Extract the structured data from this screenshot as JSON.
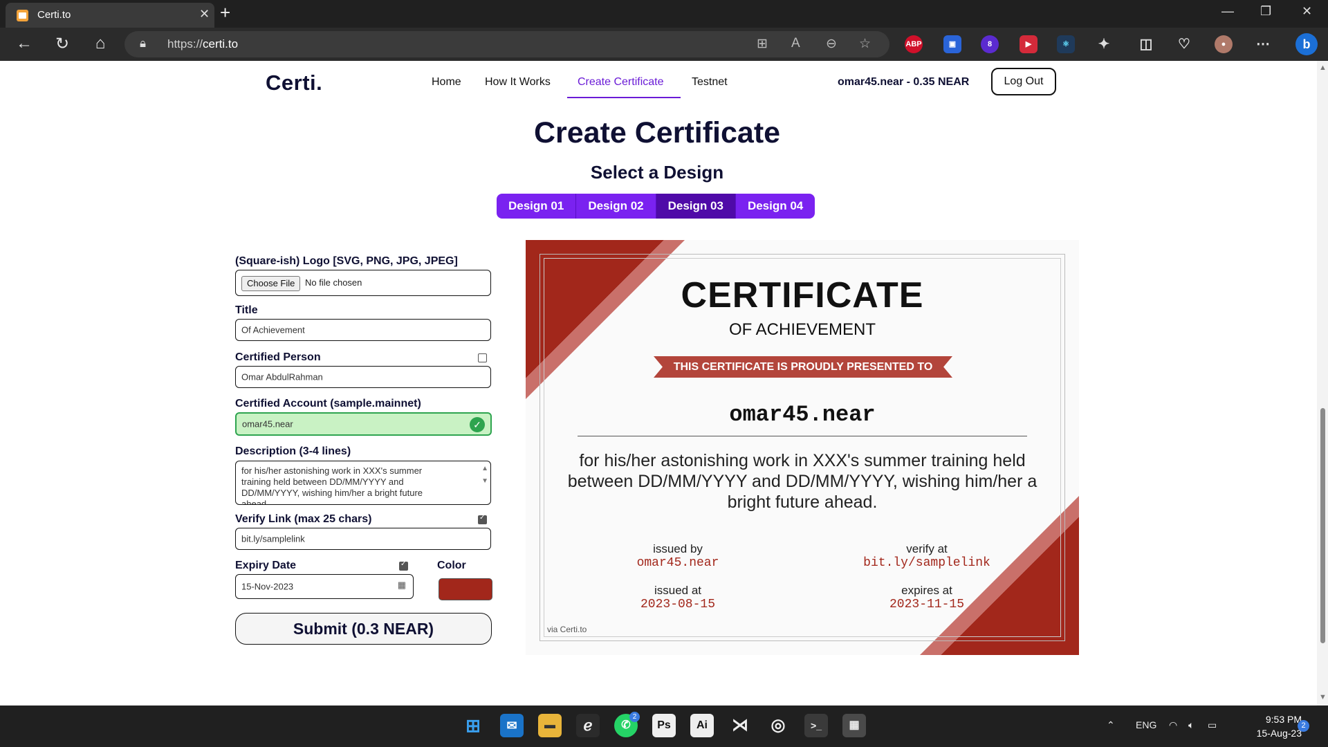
{
  "browser": {
    "tab_title": "Certi.to",
    "url_prefix": "https://",
    "url_host": "certi.to",
    "extension_badge": "8"
  },
  "nav": {
    "logo": "Certi.",
    "links": [
      "Home",
      "How It Works",
      "Create Certificate",
      "Testnet"
    ],
    "account": "omar45.near - 0.35 NEAR",
    "logout": "Log Out"
  },
  "page": {
    "title": "Create Certificate",
    "subtitle": "Select a Design",
    "designs": [
      "Design 01",
      "Design 02",
      "Design 03",
      "Design 04"
    ],
    "active_design": "Design 03"
  },
  "form": {
    "logo_label": "(Square-ish) Logo [SVG, PNG, JPG, JPEG]",
    "choose_file": "Choose File",
    "no_file": "No file chosen",
    "title_label": "Title",
    "title_value": "Of Achievement",
    "person_label": "Certified Person",
    "person_value": "Omar AbdulRahman",
    "account_label": "Certified Account (sample.mainnet)",
    "account_value": "omar45.near",
    "desc_label": "Description (3-4 lines)",
    "desc_value": "for his/her astonishing work in XXX's summer training held between DD/MM/YYYY and DD/MM/YYYY, wishing him/her a bright future ahead.",
    "verify_label": "Verify Link (max 25 chars)",
    "verify_value": "bit.ly/samplelink",
    "expiry_label": "Expiry Date",
    "expiry_value": "15-Nov-2023",
    "color_label": "Color",
    "color_value": "#a2271b",
    "submit": "Submit (0.3 NEAR)"
  },
  "certificate": {
    "heading": "CERTIFICATE",
    "subheading": "OF ACHIEVEMENT",
    "ribbon": "THIS CERTIFICATE IS PROUDLY PRESENTED TO",
    "recipient": "omar45.near",
    "description": "for his/her astonishing work in XXX's summer training held between DD/MM/YYYY and DD/MM/YYYY, wishing him/her a bright future ahead.",
    "issued_by_label": "issued by",
    "issued_by": "omar45.near",
    "verify_label": "verify at",
    "verify": "bit.ly/samplelink",
    "issued_at_label": "issued at",
    "issued_at": "2023-08-15",
    "expires_label": "expires at",
    "expires": "2023-11-15",
    "via": "via Certi.to",
    "accent_color": "#a2271b"
  },
  "taskbar": {
    "whatsapp_badge": "2",
    "ps_label": "Ps",
    "ai_label": "Ai",
    "lang": "ENG",
    "time": "9:53 PM",
    "date": "15-Aug-23",
    "notification_count": "2"
  }
}
